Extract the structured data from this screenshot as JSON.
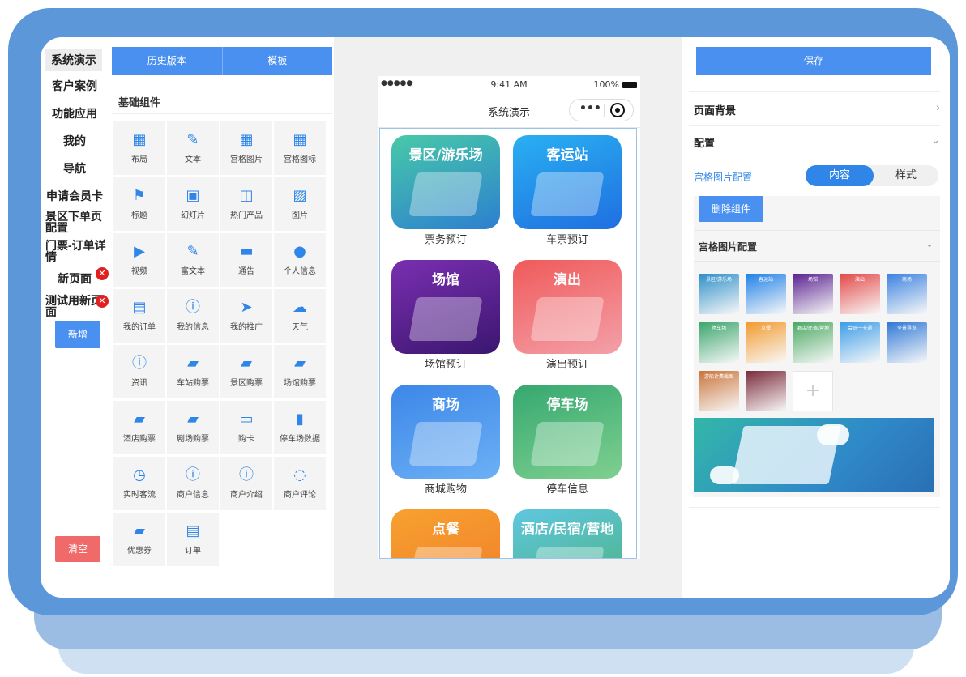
{
  "pages": {
    "items": [
      "系统演示",
      "客户案例",
      "功能应用",
      "我的",
      "导航",
      "申请会员卡",
      "景区下单页配置",
      "门票-订单详情",
      "新页面",
      "测试用新页面"
    ],
    "add_label": "新增",
    "clear_label": "清空"
  },
  "components": {
    "tabs": [
      "历史版本",
      "模板"
    ],
    "section_title": "基础组件",
    "items": [
      {
        "label": "布局",
        "icon": "layout-icon"
      },
      {
        "label": "文本",
        "icon": "text-icon"
      },
      {
        "label": "宫格图片",
        "icon": "grid-image-icon"
      },
      {
        "label": "宫格图标",
        "icon": "grid-icon-icon"
      },
      {
        "label": "标题",
        "icon": "flag-icon"
      },
      {
        "label": "幻灯片",
        "icon": "image-icon"
      },
      {
        "label": "热门产品",
        "icon": "book-icon"
      },
      {
        "label": "图片",
        "icon": "picture-icon"
      },
      {
        "label": "视频",
        "icon": "video-icon"
      },
      {
        "label": "富文本",
        "icon": "edit-icon"
      },
      {
        "label": "通告",
        "icon": "message-icon"
      },
      {
        "label": "个人信息",
        "icon": "user-icon"
      },
      {
        "label": "我的订单",
        "icon": "clipboard-icon"
      },
      {
        "label": "我的信息",
        "icon": "info-icon"
      },
      {
        "label": "我的推广",
        "icon": "send-icon"
      },
      {
        "label": "天气",
        "icon": "cloud-icon"
      },
      {
        "label": "资讯",
        "icon": "info-icon"
      },
      {
        "label": "车站购票",
        "icon": "ticket-icon"
      },
      {
        "label": "景区购票",
        "icon": "ticket-icon"
      },
      {
        "label": "场馆购票",
        "icon": "ticket-icon"
      },
      {
        "label": "酒店购票",
        "icon": "ticket-icon"
      },
      {
        "label": "剧场购票",
        "icon": "ticket-icon"
      },
      {
        "label": "购卡",
        "icon": "card-icon"
      },
      {
        "label": "停车场数据",
        "icon": "bar-chart-icon"
      },
      {
        "label": "实时客流",
        "icon": "clock-icon"
      },
      {
        "label": "商户信息",
        "icon": "info-icon"
      },
      {
        "label": "商户介绍",
        "icon": "info-icon"
      },
      {
        "label": "商户评论",
        "icon": "comment-icon"
      },
      {
        "label": "优惠券",
        "icon": "ticket-icon"
      },
      {
        "label": "订单",
        "icon": "clipboard-icon"
      }
    ]
  },
  "phone": {
    "carrier": "●●●●● ",
    "time": "9:41 AM",
    "battery": "100%",
    "title": "系统演示",
    "tiles": [
      {
        "caption": "景区/游乐场",
        "label": "票务预订",
        "colors": [
          "#47c9a8",
          "#2d7fd0"
        ]
      },
      {
        "caption": "客运站",
        "label": "车票预订",
        "colors": [
          "#2ab0f2",
          "#1f6fe0"
        ]
      },
      {
        "caption": "场馆",
        "label": "场馆预订",
        "colors": [
          "#7a2fb0",
          "#3b1670"
        ]
      },
      {
        "caption": "演出",
        "label": "演出预订",
        "colors": [
          "#f05a5a",
          "#f3a0a8"
        ]
      },
      {
        "caption": "商场",
        "label": "商城购物",
        "colors": [
          "#3c87e8",
          "#6cb0f5"
        ]
      },
      {
        "caption": "停车场",
        "label": "停车信息",
        "colors": [
          "#35a870",
          "#7fd08f"
        ]
      },
      {
        "caption": "点餐",
        "label": "",
        "colors": [
          "#f7a12f",
          "#f07c2a"
        ]
      },
      {
        "caption": "酒店/民宿/营地",
        "label": "",
        "colors": [
          "#5fc7e0",
          "#4ab07a"
        ]
      }
    ]
  },
  "config": {
    "save_label": "保存",
    "page_bg_label": "页面背景",
    "config_label": "配置",
    "grid_config_label": "宫格图片配置",
    "seg_on": "内容",
    "seg_off": "样式",
    "delete_label": "删除组件",
    "section_label": "宫格图片配置",
    "thumbs": [
      {
        "caption": "景区/游乐场",
        "color": "#2d8fc8"
      },
      {
        "caption": "客运站",
        "color": "#1f80e8"
      },
      {
        "caption": "场馆",
        "color": "#5a2290"
      },
      {
        "caption": "演出",
        "color": "#e44848"
      },
      {
        "caption": "商场",
        "color": "#3b82e0"
      },
      {
        "caption": "停车场",
        "color": "#3aa56c"
      },
      {
        "caption": "点餐",
        "color": "#f29a2e"
      },
      {
        "caption": "酒店/民宿/营地",
        "color": "#4aa862"
      },
      {
        "caption": "会员一卡通",
        "color": "#3c9ce8"
      },
      {
        "caption": "全景导览",
        "color": "#2e78d6"
      },
      {
        "caption": "游船计费截图",
        "color": "#c9743a"
      },
      {
        "caption": "",
        "color": "#7a2a3a"
      }
    ]
  }
}
